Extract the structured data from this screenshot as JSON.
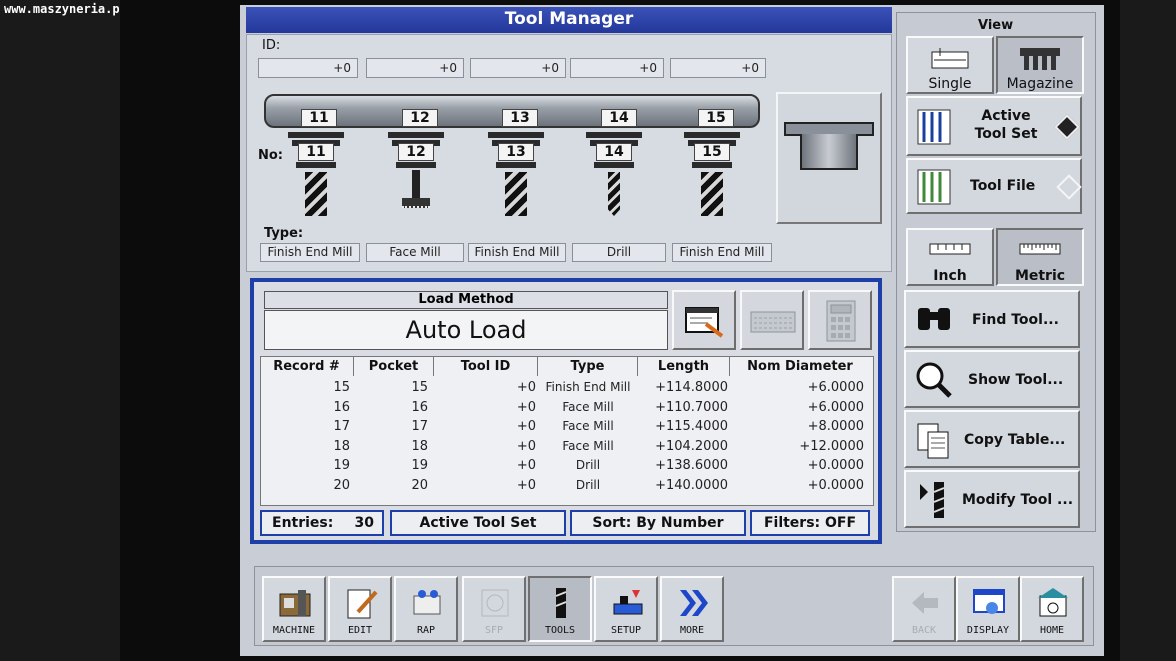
{
  "watermark": "www.maszyneria.pl",
  "window": {
    "title": "Tool Manager"
  },
  "tool_display": {
    "id_label": "ID:",
    "no_label": "No:",
    "type_label": "Type:",
    "ids": [
      "+0",
      "+0",
      "+0",
      "+0",
      "+0"
    ],
    "tools": [
      {
        "no": "11",
        "type": "Finish End Mill",
        "shape": "end-mill"
      },
      {
        "no": "12",
        "type": "Face Mill",
        "shape": "face-mill"
      },
      {
        "no": "13",
        "type": "Finish End Mill",
        "shape": "end-mill"
      },
      {
        "no": "14",
        "type": "Drill",
        "shape": "drill"
      },
      {
        "no": "15",
        "type": "Finish End Mill",
        "shape": "end-mill"
      }
    ]
  },
  "load": {
    "method_label": "Load Method",
    "method_value": "Auto Load",
    "buttons": [
      "load-editor-icon",
      "keyboard-icon",
      "calculator-icon"
    ]
  },
  "table": {
    "headers": [
      "Record #",
      "Pocket",
      "Tool ID",
      "Type",
      "Length",
      "Nom Diameter"
    ],
    "rows": [
      [
        "15",
        "15",
        "+0",
        "Finish End Mill",
        "+114.8000",
        "+6.0000"
      ],
      [
        "16",
        "16",
        "+0",
        "Face Mill",
        "+110.7000",
        "+6.0000"
      ],
      [
        "17",
        "17",
        "+0",
        "Face Mill",
        "+115.4000",
        "+8.0000"
      ],
      [
        "18",
        "18",
        "+0",
        "Face Mill",
        "+104.2000",
        "+12.0000"
      ],
      [
        "19",
        "19",
        "+0",
        "Drill",
        "+138.6000",
        "+0.0000"
      ],
      [
        "20",
        "20",
        "+0",
        "Drill",
        "+140.0000",
        "+0.0000"
      ]
    ]
  },
  "status": {
    "entries_label": "Entries:",
    "entries_value": "30",
    "tool_set": "Active Tool Set",
    "sort": "Sort: By Number",
    "filters": "Filters: OFF"
  },
  "right_panel": {
    "view_label": "View",
    "single": "Single",
    "magazine": "Magazine",
    "active_tool_set": [
      "Active",
      "Tool Set"
    ],
    "tool_file": "Tool File",
    "inch": "Inch",
    "metric": "Metric",
    "find_tool": "Find Tool...",
    "show_tool": "Show Tool...",
    "copy_table": "Copy Table...",
    "modify_tool": "Modify Tool ..."
  },
  "bottom_bar": {
    "buttons": [
      {
        "label": "MACHINE",
        "icon": "machine-icon",
        "state": "normal"
      },
      {
        "label": "EDIT",
        "icon": "edit-icon",
        "state": "normal"
      },
      {
        "label": "RAP",
        "icon": "rap-icon",
        "state": "normal"
      },
      {
        "label": "SFP",
        "icon": "sfp-icon",
        "state": "disabled"
      },
      {
        "label": "TOOLS",
        "icon": "tools-icon",
        "state": "pressed"
      },
      {
        "label": "SETUP",
        "icon": "setup-icon",
        "state": "normal"
      },
      {
        "label": "MORE",
        "icon": "more-arrows-icon",
        "state": "normal"
      },
      {
        "label": "BACK",
        "icon": "back-icon",
        "state": "disabled"
      },
      {
        "label": "DISPLAY",
        "icon": "display-icon",
        "state": "normal"
      },
      {
        "label": "HOME",
        "icon": "home-icon",
        "state": "normal"
      }
    ]
  },
  "colors": {
    "title_bar": "#24379a",
    "frame_blue": "#1e3ea8",
    "panel_grey": "#c9cdd6"
  }
}
